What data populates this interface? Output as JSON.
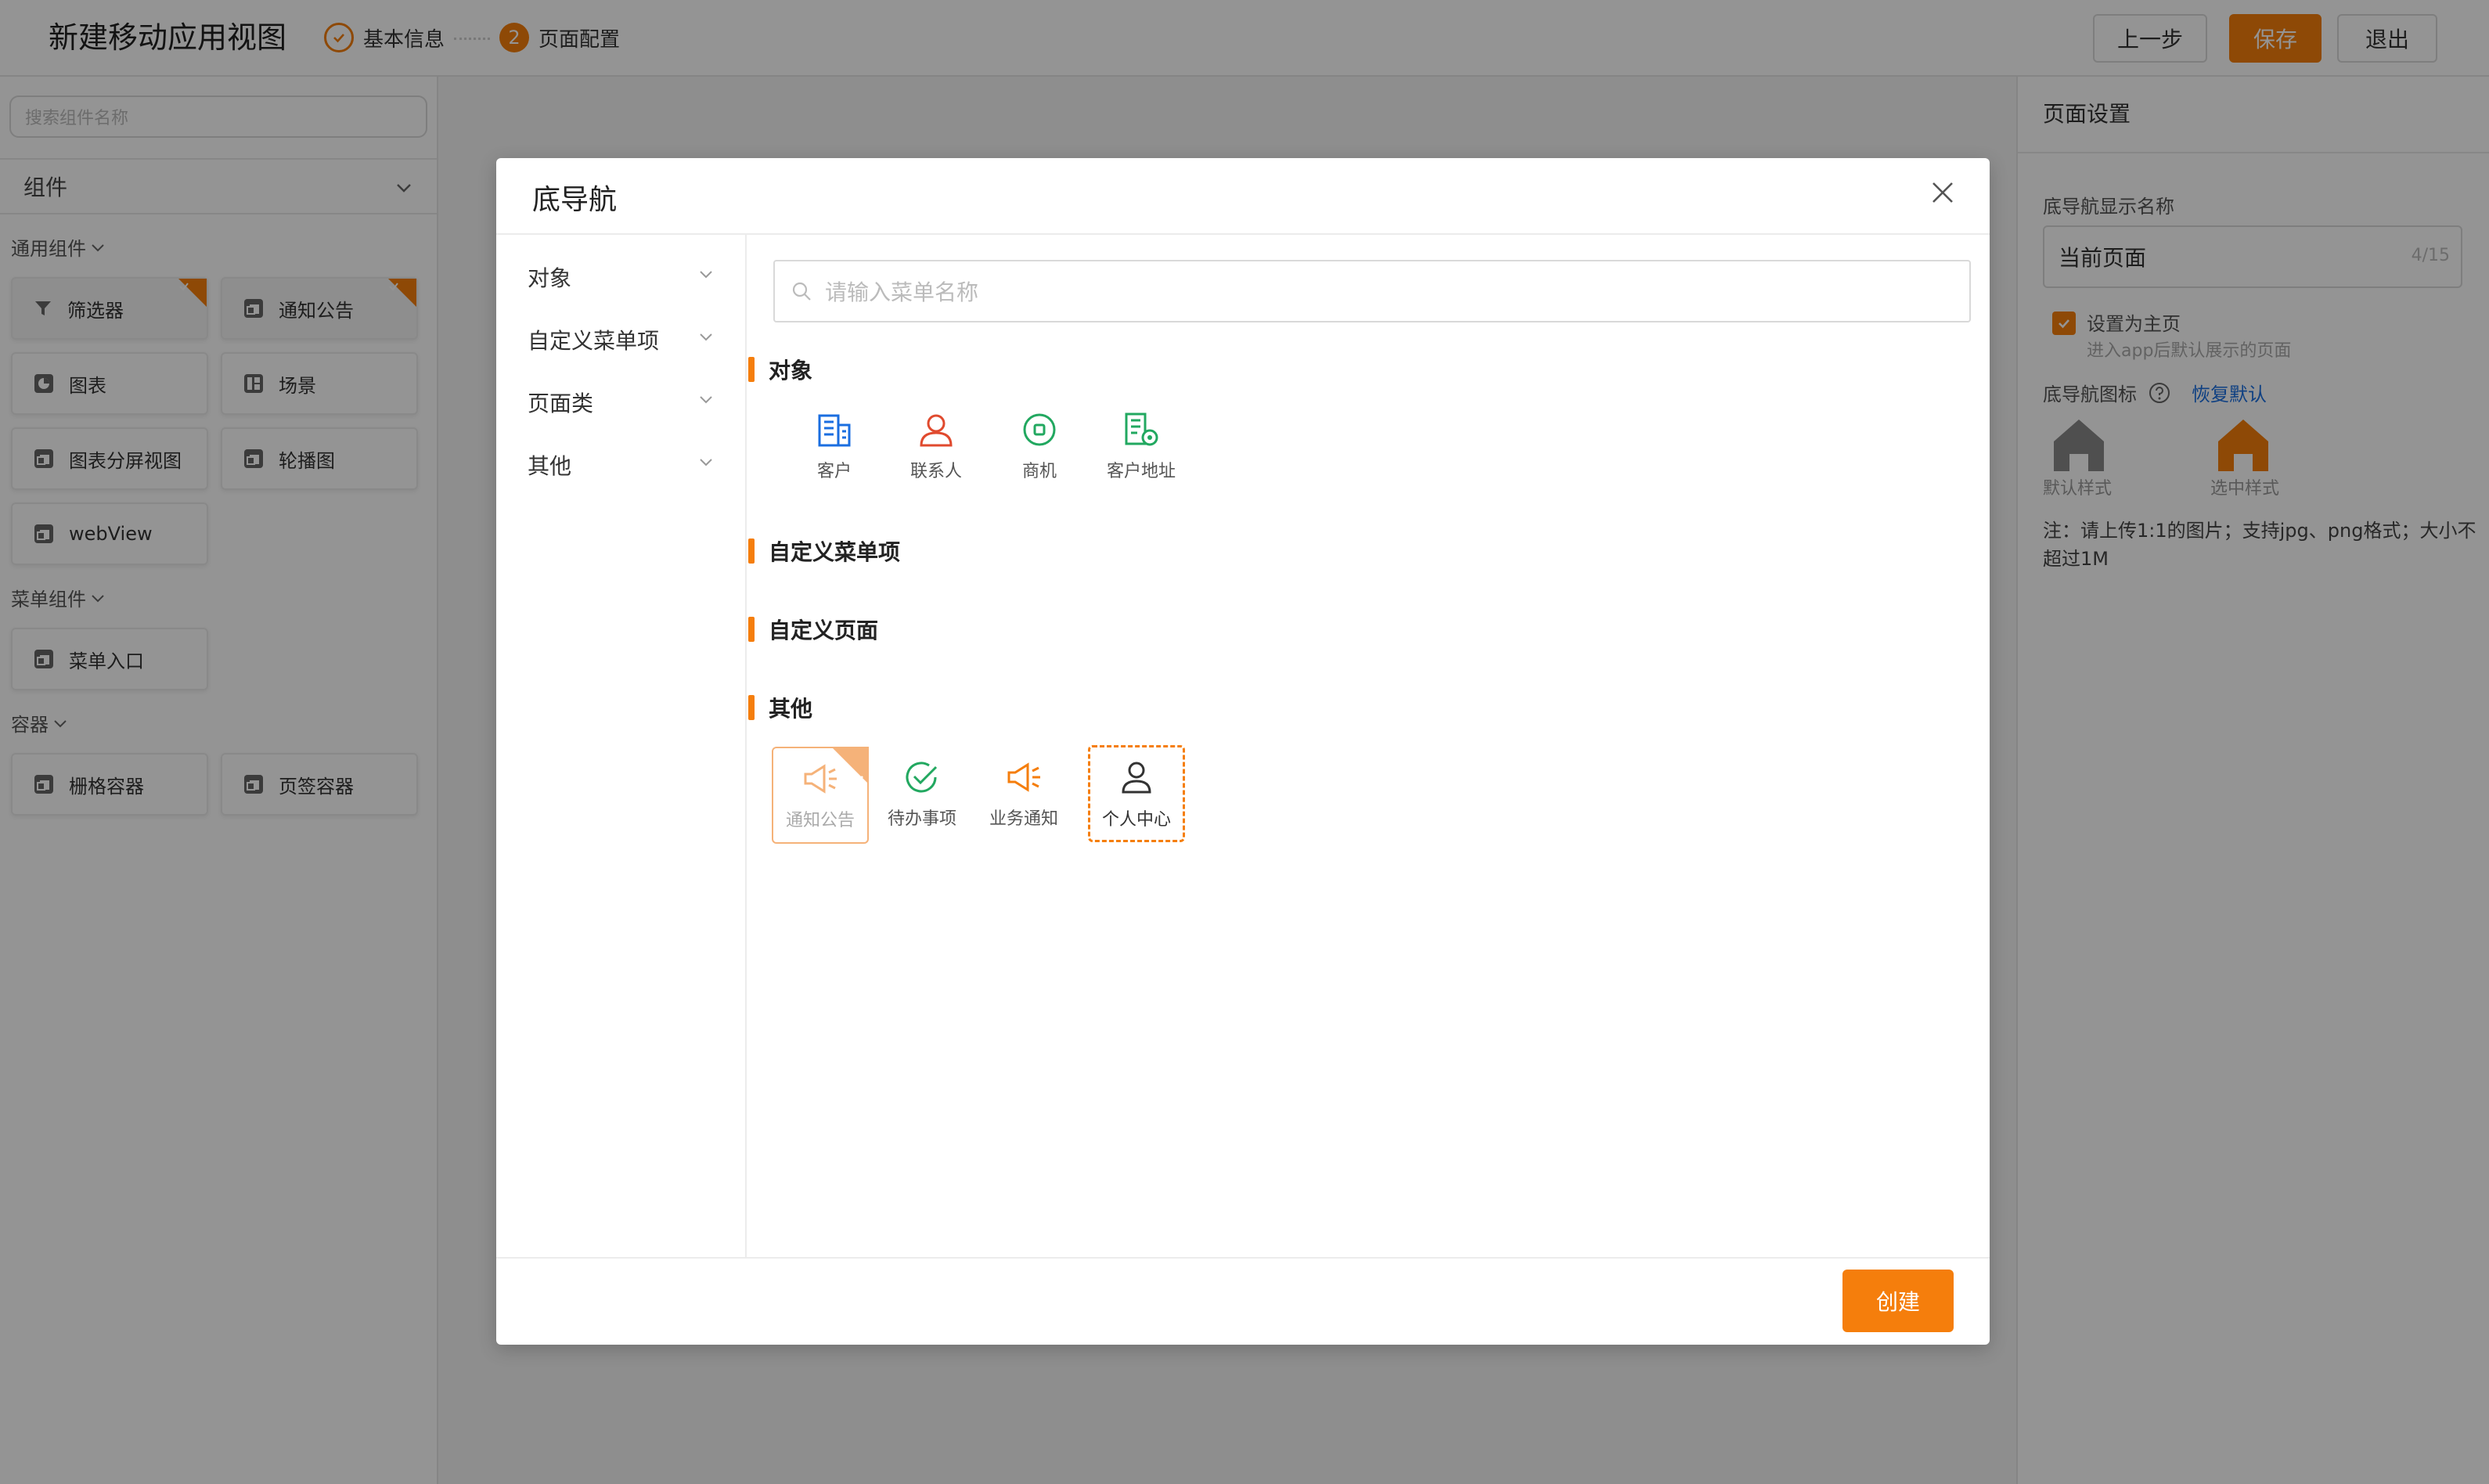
{
  "header": {
    "title": "新建移动应用视图",
    "steps": [
      {
        "label": "基本信息",
        "number": ""
      },
      {
        "label": "页面配置",
        "number": "2"
      }
    ],
    "buttons": {
      "prev": "上一步",
      "save": "保存",
      "exit": "退出"
    }
  },
  "left": {
    "search_placeholder": "搜索组件名称",
    "components_header": "组件",
    "groups": [
      {
        "title": "通用组件",
        "items": [
          "筛选器",
          "通知公告",
          "图表",
          "场景",
          "图表分屏视图",
          "轮播图",
          "webView"
        ]
      },
      {
        "title": "菜单组件",
        "items": [
          "菜单入口"
        ]
      },
      {
        "title": "容器",
        "items": [
          "栅格容器",
          "页签容器"
        ]
      }
    ]
  },
  "right": {
    "title": "页面设置",
    "name_label": "底导航显示名称",
    "name_value": "当前页面",
    "name_count": "4/15",
    "home_check_label": "设置为主页",
    "home_check_sub": "进入app后默认展示的页面",
    "icon_label": "底导航图标",
    "restore_default": "恢复默认",
    "icon_styles": [
      "默认样式",
      "选中样式"
    ],
    "note": "注：请上传1:1的图片；支持jpg、png格式；大小不超过1M",
    "colors": {
      "default_icon": "#888888",
      "selected_icon": "#f57e0c"
    }
  },
  "modal": {
    "title": "底导航",
    "sidebar": [
      "对象",
      "自定义菜单项",
      "页面类",
      "其他"
    ],
    "search_placeholder": "请输入菜单名称",
    "sections": [
      {
        "title": "对象",
        "items": [
          "客户",
          "联系人",
          "商机",
          "客户地址"
        ]
      },
      {
        "title": "自定义菜单项",
        "items": []
      },
      {
        "title": "自定义页面",
        "items": []
      },
      {
        "title": "其他",
        "items": [
          "通知公告",
          "待办事项",
          "业务通知",
          "个人中心"
        ]
      }
    ],
    "create_button": "创建"
  },
  "theme": {
    "accent": "#f57e0c",
    "link": "#1a6ee0"
  }
}
